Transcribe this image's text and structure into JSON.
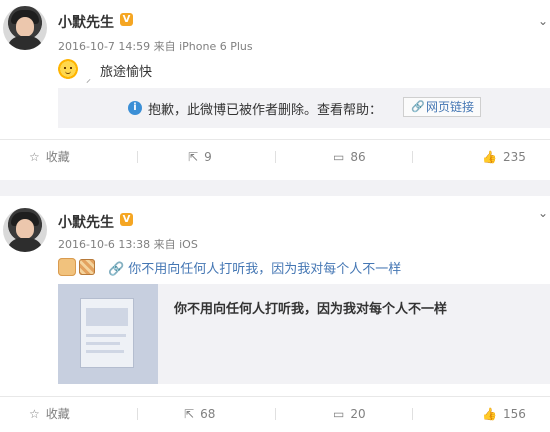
{
  "posts": [
    {
      "name": "小默先生",
      "meta": "2016-10-7 14:59 来自 iPhone 6 Plus",
      "text": "旅途愉快",
      "deleted_notice": "抱歉，此微博已被作者删除。查看帮助：",
      "help_link": "网页链接",
      "actions": {
        "fav": "收藏",
        "repost": "9",
        "comment": "86",
        "like": "235"
      }
    },
    {
      "name": "小默先生",
      "meta": "2016-10-6 13:38 来自 iOS",
      "link_text": "你不用向任何人打听我，因为我对每个人不一样",
      "card_title": "你不用向任何人打听我，因为我对每个人不一样",
      "actions": {
        "fav": "收藏",
        "repost": "68",
        "comment": "20",
        "like": "156"
      }
    }
  ],
  "icons": {
    "verified": "verified-badge-icon",
    "star": "star-icon",
    "repost": "repost-icon",
    "comment": "comment-icon",
    "like": "thumbs-up-icon",
    "link": "link-icon",
    "info": "info-icon",
    "chevron": "chevron-down-icon"
  },
  "colors": {
    "link": "#4577b4",
    "badge": "#f5a623",
    "info": "#3b8fd6",
    "panel": "#f2f2f5"
  }
}
